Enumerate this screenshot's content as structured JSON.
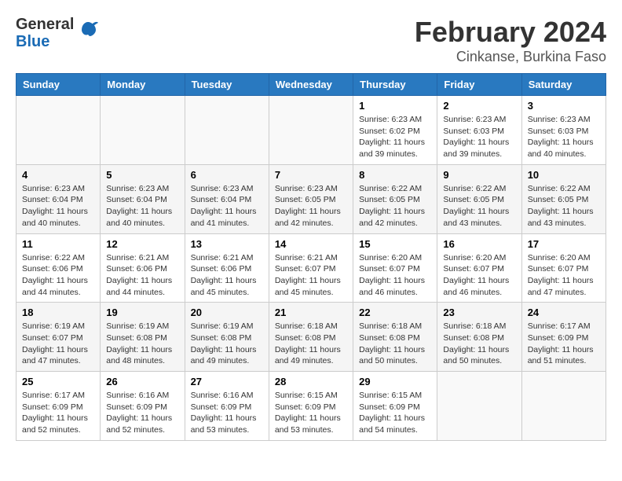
{
  "header": {
    "logo_general": "General",
    "logo_blue": "Blue",
    "month_title": "February 2024",
    "location": "Cinkanse, Burkina Faso"
  },
  "calendar": {
    "days_of_week": [
      "Sunday",
      "Monday",
      "Tuesday",
      "Wednesday",
      "Thursday",
      "Friday",
      "Saturday"
    ],
    "weeks": [
      [
        {
          "date": "",
          "info": ""
        },
        {
          "date": "",
          "info": ""
        },
        {
          "date": "",
          "info": ""
        },
        {
          "date": "",
          "info": ""
        },
        {
          "date": "1",
          "info": "Sunrise: 6:23 AM\nSunset: 6:02 PM\nDaylight: 11 hours and 39 minutes."
        },
        {
          "date": "2",
          "info": "Sunrise: 6:23 AM\nSunset: 6:03 PM\nDaylight: 11 hours and 39 minutes."
        },
        {
          "date": "3",
          "info": "Sunrise: 6:23 AM\nSunset: 6:03 PM\nDaylight: 11 hours and 40 minutes."
        }
      ],
      [
        {
          "date": "4",
          "info": "Sunrise: 6:23 AM\nSunset: 6:04 PM\nDaylight: 11 hours and 40 minutes."
        },
        {
          "date": "5",
          "info": "Sunrise: 6:23 AM\nSunset: 6:04 PM\nDaylight: 11 hours and 40 minutes."
        },
        {
          "date": "6",
          "info": "Sunrise: 6:23 AM\nSunset: 6:04 PM\nDaylight: 11 hours and 41 minutes."
        },
        {
          "date": "7",
          "info": "Sunrise: 6:23 AM\nSunset: 6:05 PM\nDaylight: 11 hours and 42 minutes."
        },
        {
          "date": "8",
          "info": "Sunrise: 6:22 AM\nSunset: 6:05 PM\nDaylight: 11 hours and 42 minutes."
        },
        {
          "date": "9",
          "info": "Sunrise: 6:22 AM\nSunset: 6:05 PM\nDaylight: 11 hours and 43 minutes."
        },
        {
          "date": "10",
          "info": "Sunrise: 6:22 AM\nSunset: 6:05 PM\nDaylight: 11 hours and 43 minutes."
        }
      ],
      [
        {
          "date": "11",
          "info": "Sunrise: 6:22 AM\nSunset: 6:06 PM\nDaylight: 11 hours and 44 minutes."
        },
        {
          "date": "12",
          "info": "Sunrise: 6:21 AM\nSunset: 6:06 PM\nDaylight: 11 hours and 44 minutes."
        },
        {
          "date": "13",
          "info": "Sunrise: 6:21 AM\nSunset: 6:06 PM\nDaylight: 11 hours and 45 minutes."
        },
        {
          "date": "14",
          "info": "Sunrise: 6:21 AM\nSunset: 6:07 PM\nDaylight: 11 hours and 45 minutes."
        },
        {
          "date": "15",
          "info": "Sunrise: 6:20 AM\nSunset: 6:07 PM\nDaylight: 11 hours and 46 minutes."
        },
        {
          "date": "16",
          "info": "Sunrise: 6:20 AM\nSunset: 6:07 PM\nDaylight: 11 hours and 46 minutes."
        },
        {
          "date": "17",
          "info": "Sunrise: 6:20 AM\nSunset: 6:07 PM\nDaylight: 11 hours and 47 minutes."
        }
      ],
      [
        {
          "date": "18",
          "info": "Sunrise: 6:19 AM\nSunset: 6:07 PM\nDaylight: 11 hours and 47 minutes."
        },
        {
          "date": "19",
          "info": "Sunrise: 6:19 AM\nSunset: 6:08 PM\nDaylight: 11 hours and 48 minutes."
        },
        {
          "date": "20",
          "info": "Sunrise: 6:19 AM\nSunset: 6:08 PM\nDaylight: 11 hours and 49 minutes."
        },
        {
          "date": "21",
          "info": "Sunrise: 6:18 AM\nSunset: 6:08 PM\nDaylight: 11 hours and 49 minutes."
        },
        {
          "date": "22",
          "info": "Sunrise: 6:18 AM\nSunset: 6:08 PM\nDaylight: 11 hours and 50 minutes."
        },
        {
          "date": "23",
          "info": "Sunrise: 6:18 AM\nSunset: 6:08 PM\nDaylight: 11 hours and 50 minutes."
        },
        {
          "date": "24",
          "info": "Sunrise: 6:17 AM\nSunset: 6:09 PM\nDaylight: 11 hours and 51 minutes."
        }
      ],
      [
        {
          "date": "25",
          "info": "Sunrise: 6:17 AM\nSunset: 6:09 PM\nDaylight: 11 hours and 52 minutes."
        },
        {
          "date": "26",
          "info": "Sunrise: 6:16 AM\nSunset: 6:09 PM\nDaylight: 11 hours and 52 minutes."
        },
        {
          "date": "27",
          "info": "Sunrise: 6:16 AM\nSunset: 6:09 PM\nDaylight: 11 hours and 53 minutes."
        },
        {
          "date": "28",
          "info": "Sunrise: 6:15 AM\nSunset: 6:09 PM\nDaylight: 11 hours and 53 minutes."
        },
        {
          "date": "29",
          "info": "Sunrise: 6:15 AM\nSunset: 6:09 PM\nDaylight: 11 hours and 54 minutes."
        },
        {
          "date": "",
          "info": ""
        },
        {
          "date": "",
          "info": ""
        }
      ]
    ]
  }
}
